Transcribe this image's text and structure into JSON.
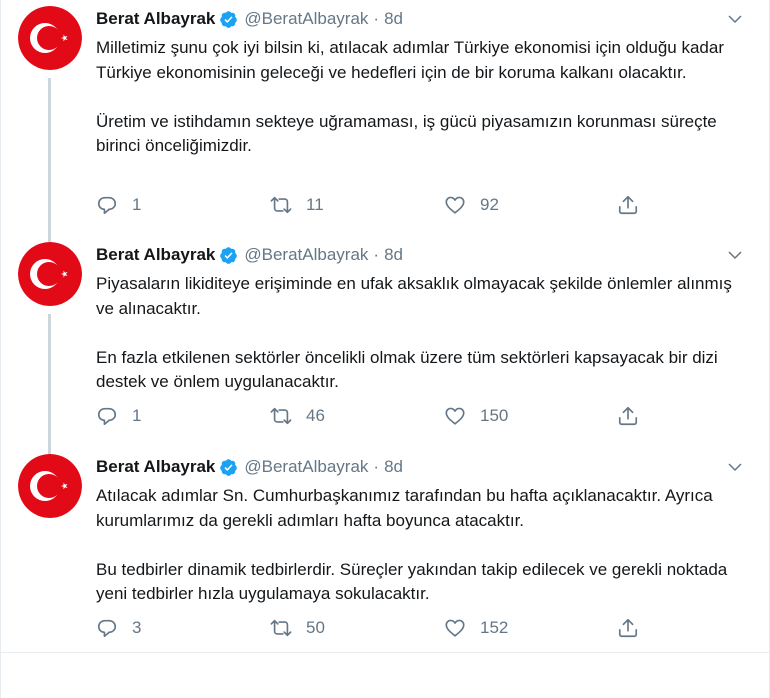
{
  "tweets": [
    {
      "name": "Berat Albayrak",
      "handle": "@BeratAlbayrak",
      "dot": "·",
      "time": "8d",
      "paragraphs": [
        "Milletimiz şunu çok iyi bilsin ki, atılacak adımlar Türkiye ekonomisi için olduğu kadar Türkiye ekonomisinin geleceği ve hedefleri için de bir koruma kalkanı olacaktır.",
        "Üretim ve istihdamın sekteye uğramaması, iş gücü piyasamızın korunması süreçte birinci önceliğimizdir."
      ],
      "replies": "1",
      "retweets": "11",
      "likes": "92"
    },
    {
      "name": "Berat Albayrak",
      "handle": "@BeratAlbayrak",
      "dot": "·",
      "time": "8d",
      "paragraphs": [
        "Piyasaların likiditeye erişiminde en ufak aksaklık olmayacak şekilde önlemler alınmış ve alınacaktır.",
        "En fazla etkilenen sektörler öncelikli olmak üzere tüm sektörleri kapsayacak bir dizi destek ve önlem uygulanacaktır."
      ],
      "replies": "1",
      "retweets": "46",
      "likes": "150"
    },
    {
      "name": "Berat Albayrak",
      "handle": "@BeratAlbayrak",
      "dot": "·",
      "time": "8d",
      "paragraphs": [
        "Atılacak adımlar Sn. Cumhurbaşkanımız tarafından bu hafta açıklanacaktır. Ayrıca kurumlarımız da gerekli adımları hafta boyunca atacaktır.",
        "Bu tedbirler dinamik tedbirlerdir. Süreçler yakından takip edilecek ve gerekli noktada yeni tedbirler hızla uygulamaya sokulacaktır."
      ],
      "replies": "3",
      "retweets": "50",
      "likes": "152"
    }
  ],
  "icons": {
    "avatar": "turkish-flag-icon",
    "verified": "verified-badge-icon",
    "caret": "chevron-down-icon",
    "reply": "reply-icon",
    "retweet": "retweet-icon",
    "like": "heart-icon",
    "share": "share-icon"
  },
  "colors": {
    "flag_red": "#e30a17",
    "verified_blue": "#1da1f2",
    "secondary_text": "#657786",
    "thread_line": "#ccd6dd"
  }
}
